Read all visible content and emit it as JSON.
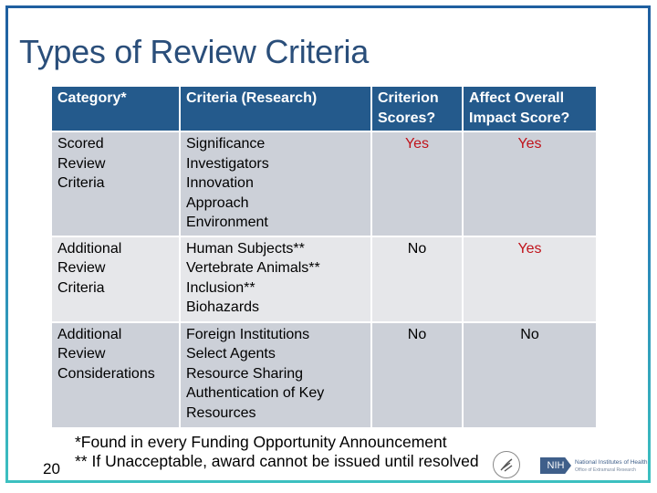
{
  "slide": {
    "title": "Types of Review Criteria",
    "page_number": "20"
  },
  "table": {
    "headers": [
      "Category*",
      "Criteria (Research)",
      "Criterion Scores?",
      "Affect Overall Impact Score?"
    ],
    "header_lines": [
      [
        "Category*"
      ],
      [
        "Criteria (Research)"
      ],
      [
        "Criterion",
        "Scores?"
      ],
      [
        "Affect Overall",
        "Impact Score?"
      ]
    ],
    "rows": [
      {
        "category_lines": [
          "Scored",
          "Review",
          "Criteria"
        ],
        "criteria": [
          "Significance",
          "Investigators",
          "Innovation",
          "Approach",
          "Environment"
        ],
        "criterion_scores": "Yes",
        "affect_overall": "Yes"
      },
      {
        "category_lines": [
          "Additional",
          "Review",
          "Criteria"
        ],
        "criteria": [
          "Human Subjects**",
          "Vertebrate Animals**",
          "Inclusion**",
          "Biohazards"
        ],
        "criterion_scores": "No",
        "affect_overall": "Yes"
      },
      {
        "category_lines": [
          "Additional",
          "Review",
          "Considerations"
        ],
        "criteria": [
          "Foreign Institutions",
          "Select Agents",
          "Resource Sharing",
          "Authentication of Key",
          "Resources"
        ],
        "criterion_scores": "No",
        "affect_overall": "No"
      }
    ]
  },
  "footnotes": [
    "*Found in every Funding Opportunity Announcement",
    "** If Unacceptable, award cannot be issued until resolved"
  ],
  "logos": {
    "hhs_seal": "hhs-seal-icon",
    "nih_badge": "NIH",
    "nih_name": "National Institutes of Health",
    "nih_office": "Office of Extramural Research"
  },
  "colors": {
    "header_bg": "#245a8c",
    "yes_color": "#c0131b",
    "title_color": "#2a4e7a",
    "row_dark": "#ccd0d8",
    "row_light": "#e6e7ea"
  }
}
